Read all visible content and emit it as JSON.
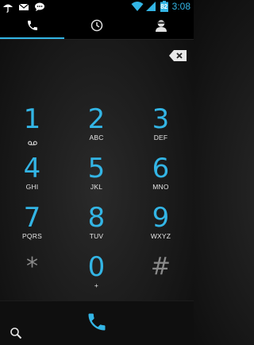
{
  "status_bar": {
    "battery_level": "82",
    "clock": "3:08",
    "icons": [
      "umbrella-icon",
      "email-icon",
      "chat-icon",
      "wifi-icon",
      "signal-icon",
      "battery-icon"
    ]
  },
  "tabs": [
    {
      "name": "phone",
      "icon": "phone-icon",
      "active": true
    },
    {
      "name": "call-log",
      "icon": "clock-icon",
      "active": false
    },
    {
      "name": "contacts",
      "icon": "contact-icon",
      "active": false
    }
  ],
  "keys": [
    {
      "digit": "1",
      "letters": ""
    },
    {
      "digit": "2",
      "letters": "ABC"
    },
    {
      "digit": "3",
      "letters": "DEF"
    },
    {
      "digit": "4",
      "letters": "GHI"
    },
    {
      "digit": "5",
      "letters": "JKL"
    },
    {
      "digit": "6",
      "letters": "MNO"
    },
    {
      "digit": "7",
      "letters": "PQRS"
    },
    {
      "digit": "8",
      "letters": "TUV"
    },
    {
      "digit": "9",
      "letters": "WXYZ"
    },
    {
      "digit": "*",
      "letters": ""
    },
    {
      "digit": "0",
      "letters": "+"
    },
    {
      "digit": "#",
      "letters": ""
    }
  ],
  "colors": {
    "accent": "#33b5e5",
    "symbol": "#8a8a8a"
  }
}
